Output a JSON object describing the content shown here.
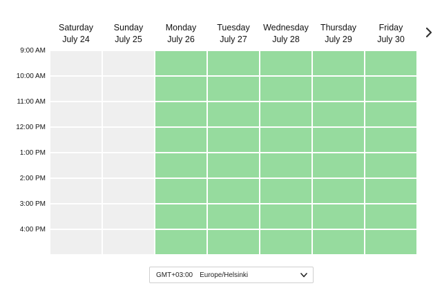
{
  "schedule": {
    "days": [
      {
        "weekday": "Saturday",
        "date": "July 24",
        "available": false
      },
      {
        "weekday": "Sunday",
        "date": "July 25",
        "available": false
      },
      {
        "weekday": "Monday",
        "date": "July 26",
        "available": true
      },
      {
        "weekday": "Tuesday",
        "date": "July 27",
        "available": true
      },
      {
        "weekday": "Wednesday",
        "date": "July 28",
        "available": true
      },
      {
        "weekday": "Thursday",
        "date": "July 29",
        "available": true
      },
      {
        "weekday": "Friday",
        "date": "July 30",
        "available": true
      }
    ],
    "time_slots": [
      "9:00 AM",
      "10:00 AM",
      "11:00 AM",
      "12:00 PM",
      "1:00 PM",
      "2:00 PM",
      "3:00 PM",
      "4:00 PM"
    ],
    "next_icon": "chevron-right-icon"
  },
  "timezone": {
    "offset": "GMT+03:00",
    "name": "Europe/Helsinki"
  },
  "colors": {
    "available": "#96db9e",
    "unavailable": "#efefef"
  }
}
